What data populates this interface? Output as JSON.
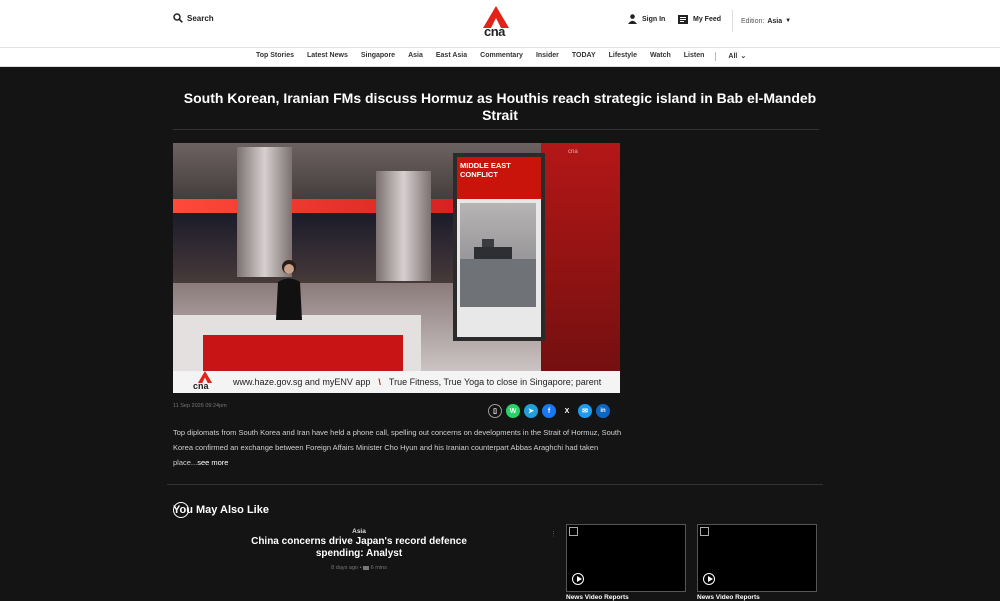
{
  "header": {
    "search_label": "Search",
    "sign_in_label": "Sign In",
    "my_feed_label": "My Feed",
    "edition_label": "Edition:",
    "edition_value": "Asia",
    "logo_text": "cna"
  },
  "nav": {
    "items": [
      "Top Stories",
      "Latest News",
      "Singapore",
      "Asia",
      "East Asia",
      "Commentary",
      "Insider",
      "TODAY",
      "Lifestyle",
      "Watch",
      "Listen"
    ],
    "all_label": "All"
  },
  "article": {
    "title": "South Korean, Iranian FMs discuss Hormuz as Houthis reach strategic island in Bab el-Mandeb Strait",
    "date": "11 Sep 2026 09:24pm",
    "description": "Top diplomats from South Korea and Iran have held a phone call, spelling out concerns on developments in the Strait of Hormuz, South Korea confirmed an exchange between Foreign Affairs Minister Cho Hyun and his Iranian counterpart Abbas Araghchi had taken place...",
    "see_more": "see more"
  },
  "video": {
    "screen_label": "MIDDLE EAST CONFLICT",
    "ticker_left": "www.haze.gov.sg and myENV app",
    "ticker_right": "True Fitness, True Yoga to close in Singapore; parent",
    "ticker_logo": "cna",
    "watermark": "cna"
  },
  "share": {
    "icons": [
      "bookmark-icon",
      "whatsapp-icon",
      "telegram-icon",
      "facebook-icon",
      "x-icon",
      "email-icon",
      "linkedin-icon"
    ],
    "glyphs": [
      "▯",
      "W",
      "➤",
      "f",
      "X",
      "✉",
      "in"
    ],
    "colors": [
      "#141414",
      "#25d366",
      "#229ed9",
      "#1877f2",
      "#141414",
      "#1d9bf0",
      "#0a66c2"
    ]
  },
  "you_may_also_like": {
    "heading": "You May Also Like",
    "card": {
      "category": "Asia",
      "title": "China concerns drive Japan's record defence spending: Analyst",
      "age": "8 days ago",
      "read_time": "6 mins"
    },
    "video_label_1": "News Video Reports",
    "video_label_2": "News Video Reports"
  },
  "colors": {
    "brand_red": "#e2231a",
    "background": "#141414"
  }
}
